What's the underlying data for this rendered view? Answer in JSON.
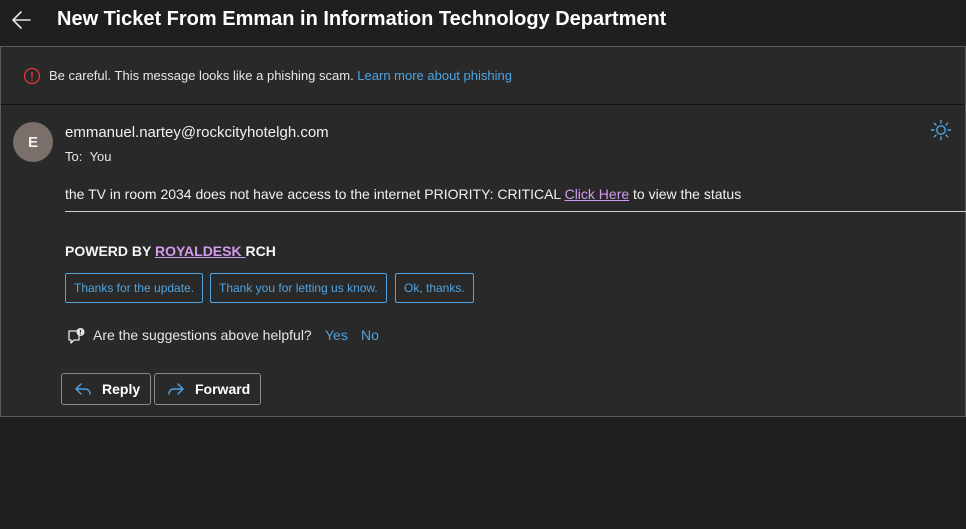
{
  "header": {
    "subject": "New Ticket From Emman in Information Technology Department"
  },
  "warning": {
    "text": "Be careful. This message looks like a phishing scam. ",
    "link": "Learn more about phishing"
  },
  "message": {
    "avatar_initial": "E",
    "sender": "emmanuel.nartey@rockcityhotelgh.com",
    "to_label": "To:",
    "to_value": "You",
    "body_before": "the TV in room 2034 does not have access to the internet PRIORITY: CRITICAL ",
    "body_link": "Click Here",
    "body_after": " to view the status",
    "powered_prefix": "POWERD BY ",
    "powered_link": "ROYALDESK ",
    "powered_suffix": "RCH"
  },
  "suggestions": [
    "Thanks for the update.",
    "Thank you for letting us know.",
    "Ok, thanks."
  ],
  "feedback": {
    "question": "Are the suggestions above helpful?",
    "yes": "Yes",
    "no": "No"
  },
  "actions": {
    "reply": "Reply",
    "forward": "Forward"
  },
  "colors": {
    "accent": "#4fa3e0",
    "link": "#d39bf0",
    "warning": "#e0393e",
    "background": "#1f1f1f",
    "card": "#292929"
  },
  "icons": [
    "back-arrow-icon",
    "warning-info-icon",
    "sun-icon",
    "feedback-icon",
    "reply-icon",
    "forward-icon"
  ]
}
